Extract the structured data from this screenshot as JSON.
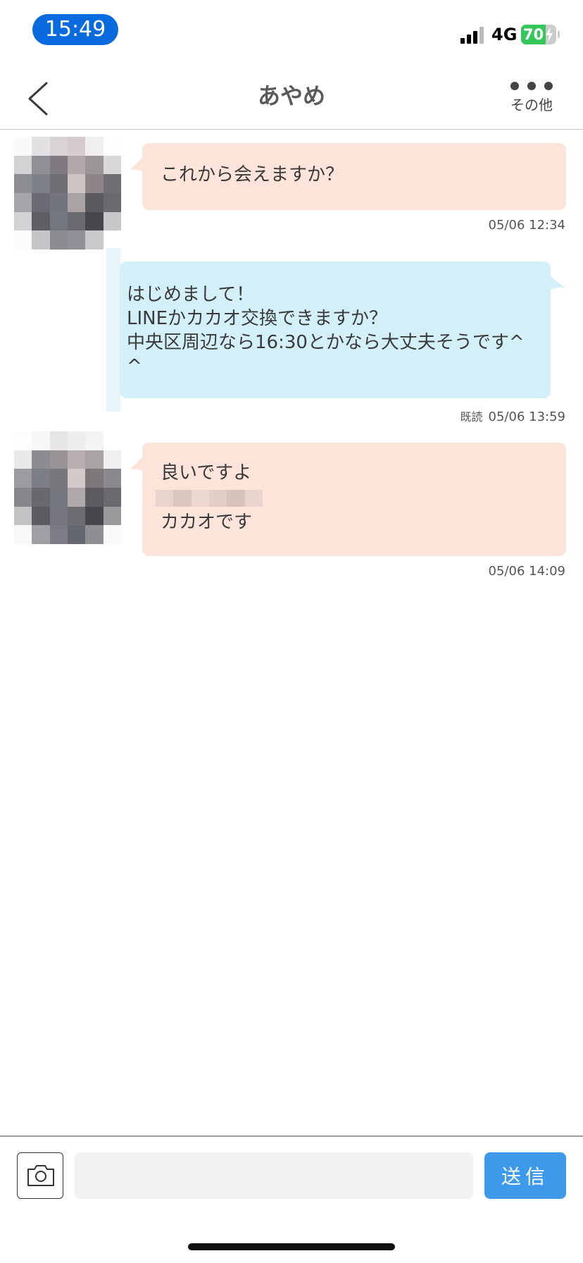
{
  "status_bar": {
    "time": "15:49",
    "network": "4G",
    "battery": "70",
    "battery_level": 0.7
  },
  "header": {
    "title": "あやめ",
    "more_label": "その他"
  },
  "messages": [
    {
      "direction": "in",
      "lines": [
        "これから会えますか？"
      ],
      "timestamp": "05/06 12:34"
    },
    {
      "direction": "out",
      "lines": [
        "はじめまして！",
        "LINEかカカオ交換できますか？",
        "中央区周辺なら16:30とかなら大丈夫そうです^",
        "^"
      ],
      "read_label": "既読",
      "timestamp": "05/06 13:59"
    },
    {
      "direction": "in",
      "lines": [
        "良いですよ",
        "カカオです"
      ],
      "timestamp": "05/06 14:09"
    }
  ],
  "input": {
    "placeholder": "",
    "send_label": "送信"
  },
  "colors": {
    "incoming_bubble": "#fde4da",
    "outgoing_bubble": "#d3f0f8",
    "send_button": "#3d9aea",
    "time_pill": "#0a6bdf",
    "battery": "#34c759"
  }
}
